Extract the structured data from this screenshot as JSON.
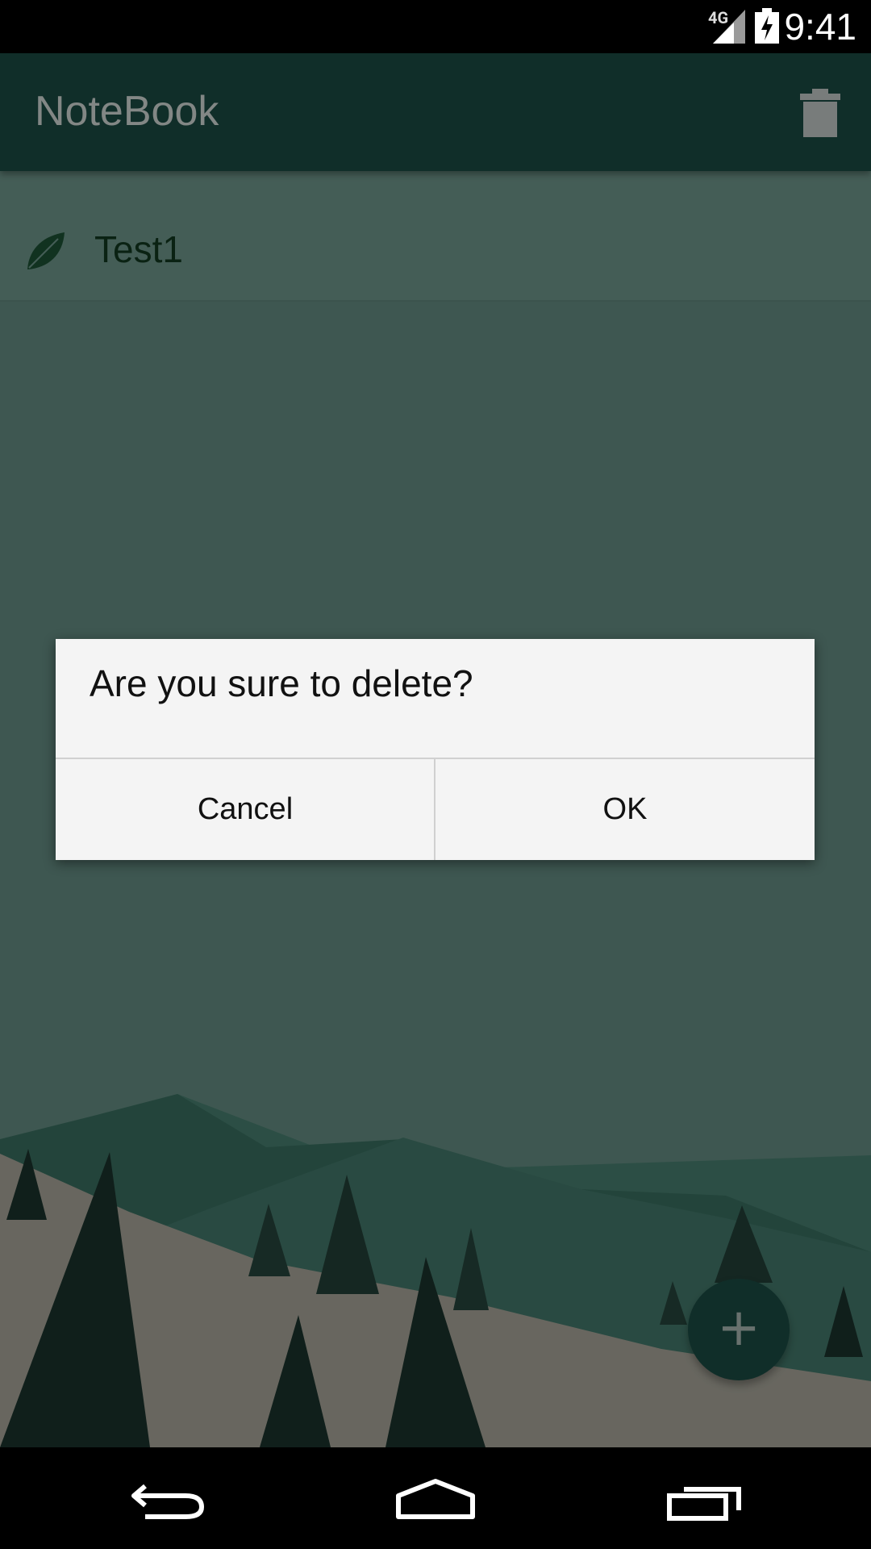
{
  "status_bar": {
    "network": "4G",
    "time": "9:41",
    "icons": [
      "signal-icon",
      "battery-charging-icon"
    ]
  },
  "app_bar": {
    "title": "NoteBook",
    "action_icon": "trash-icon"
  },
  "notes": [
    {
      "title": "Test1",
      "icon": "leaf-icon"
    }
  ],
  "dialog": {
    "message": "Are you sure to delete?",
    "cancel_label": "Cancel",
    "ok_label": "OK"
  },
  "fab": {
    "label": "+",
    "icon": "add-icon"
  },
  "nav_bar": {
    "icons": [
      "back-icon",
      "home-icon",
      "recent-apps-icon"
    ]
  },
  "colors": {
    "app_bar": "#1e5249",
    "content_bg": "#6f9c90",
    "fab": "#1e5249",
    "dialog_bg": "#f4f4f4"
  }
}
